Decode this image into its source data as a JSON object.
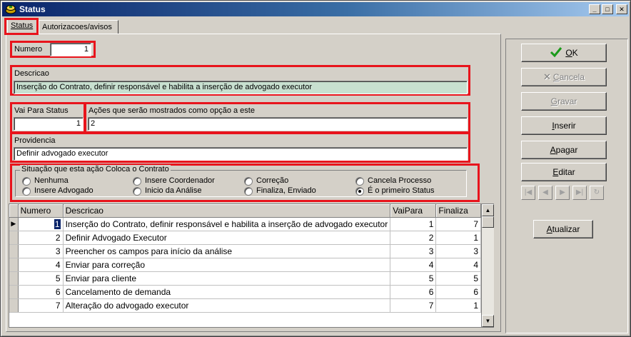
{
  "window": {
    "title": "Status",
    "controls": [
      "minimize-icon",
      "maximize-icon",
      "close-icon"
    ]
  },
  "tabs": [
    {
      "label": "Status",
      "active": true
    },
    {
      "label": "Autorizacoes/avisos",
      "active": false
    }
  ],
  "form": {
    "numero_label": "Numero",
    "numero_value": "1",
    "descricao_label": "Descricao",
    "descricao_value": "Inserção do Contrato, definir responsável e habilita a inserção de advogado executor",
    "vai_para_label": "Vai Para Status",
    "vai_para_value": "1",
    "acoes_label": "Ações que serão mostrados como opção a este",
    "acoes_value": "2",
    "providencia_label": "Providencia",
    "providencia_value": "Definir advogado executor"
  },
  "situacao": {
    "title": "Situação que esta ação Coloca o Contrato",
    "options": [
      {
        "label": "Nenhuma",
        "checked": false
      },
      {
        "label": "Insere Coordenador",
        "checked": false
      },
      {
        "label": "Correção",
        "checked": false
      },
      {
        "label": "Cancela Processo",
        "checked": false
      },
      {
        "label": "Insere Advogado",
        "checked": false
      },
      {
        "label": "Inicio da Análise",
        "checked": false
      },
      {
        "label": "Finaliza, Enviado",
        "checked": false
      },
      {
        "label": "É o primeiro Status",
        "checked": true
      }
    ]
  },
  "buttons": {
    "ok": {
      "underlined": "O",
      "rest": "K",
      "enabled": true
    },
    "cancela": {
      "underlined": "C",
      "rest": "ancela",
      "enabled": false
    },
    "gravar": {
      "underlined": "G",
      "rest": "ravar",
      "enabled": false
    },
    "inserir": {
      "underlined": "I",
      "rest": "nserir",
      "enabled": true
    },
    "apagar": {
      "underlined": "A",
      "rest": "pagar",
      "enabled": true
    },
    "editar": {
      "underlined": "E",
      "rest": "ditar",
      "enabled": true
    },
    "atualizar": {
      "underlined": "A",
      "rest": "tualizar",
      "enabled": true
    }
  },
  "navigator": [
    "first-record-icon",
    "prior-record-icon",
    "next-record-icon",
    "last-record-icon",
    "refresh-icon"
  ],
  "grid": {
    "columns": [
      "Numero",
      "Descricao",
      "VaiPara",
      "Finaliza"
    ],
    "rows": [
      [
        "1",
        "Inserção do Contrato, definir responsável e habilita a inserção de advogado executor",
        "1",
        "7"
      ],
      [
        "2",
        "Definir Advogado  Executor",
        "2",
        "1"
      ],
      [
        "3",
        "Preencher os campos para início da análise",
        "3",
        "3"
      ],
      [
        "4",
        "Enviar para correção",
        "4",
        "4"
      ],
      [
        "5",
        "Enviar para cliente",
        "5",
        "5"
      ],
      [
        "6",
        "Cancelamento de demanda",
        "6",
        "6"
      ],
      [
        "7",
        "Alteração do advogado executor",
        "7",
        "1"
      ]
    ],
    "selected_row": 0
  },
  "colors": {
    "highlight_red": "#e8141c",
    "readonly_field": "#c8e0d0",
    "selection": "#0a246a",
    "titlebar": "#0a246a"
  }
}
